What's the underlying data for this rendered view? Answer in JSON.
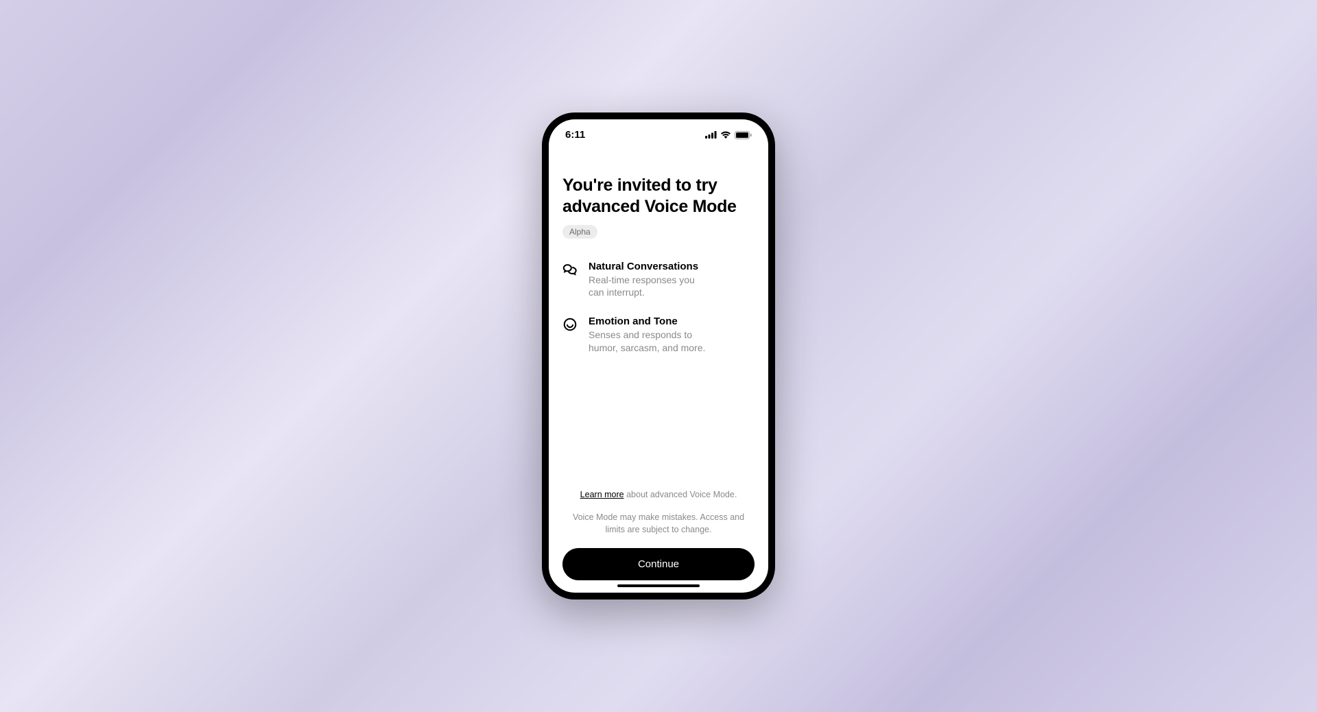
{
  "statusBar": {
    "time": "6:11"
  },
  "headline": {
    "title": "You're invited to try advanced Voice Mode",
    "badge": "Alpha"
  },
  "features": [
    {
      "icon": "chat-bubbles-icon",
      "title": "Natural Conversations",
      "description": "Real-time responses you can interrupt."
    },
    {
      "icon": "smile-icon",
      "title": "Emotion and Tone",
      "description": "Senses and responds to humor, sarcasm, and more."
    }
  ],
  "footer": {
    "learnMoreLabel": "Learn more",
    "learnMoreSuffix": " about advanced Voice Mode.",
    "disclaimer": "Voice Mode may make mistakes. Access and limits are subject to change.",
    "continueLabel": "Continue"
  }
}
